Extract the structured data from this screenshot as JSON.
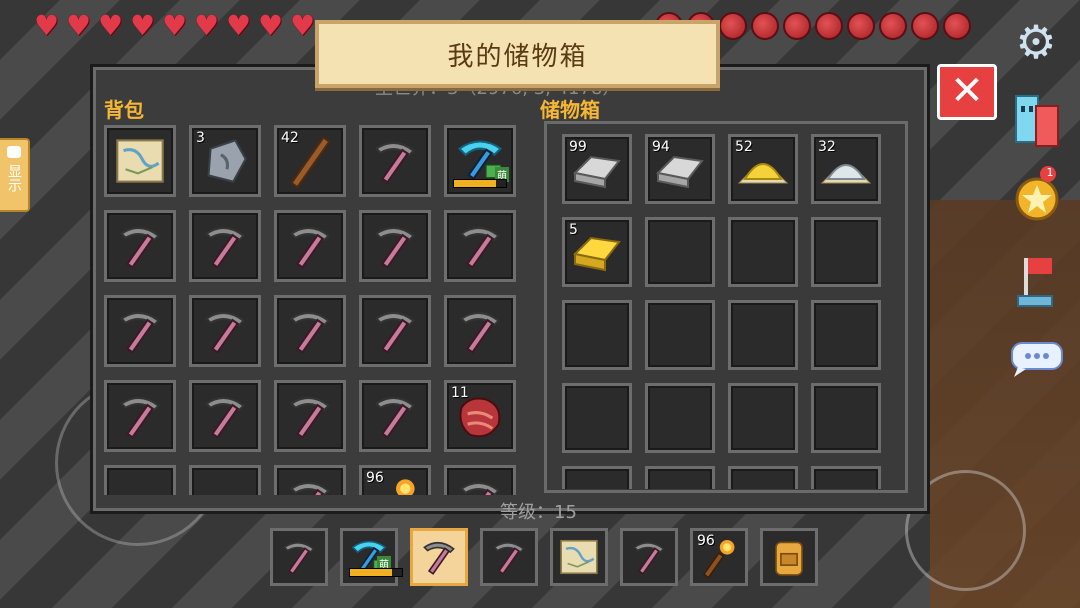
{
  "hud": {
    "hearts": 9,
    "hunger": 10
  },
  "panel": {
    "title": "我的储物箱",
    "coord_text": "主世界：3（2976, 3, 4178）",
    "level_text": "等级：15",
    "bag_label": "背包",
    "chest_label": "储物箱"
  },
  "bag_slots": [
    {
      "item": "map",
      "count": ""
    },
    {
      "item": "stone",
      "count": "3"
    },
    {
      "item": "stick",
      "count": "42"
    },
    {
      "item": "pickaxe",
      "count": ""
    },
    {
      "item": "diamond-pickaxe",
      "count": "",
      "badge": "萌",
      "durability": 0.8
    },
    {
      "item": "pickaxe",
      "count": ""
    },
    {
      "item": "pickaxe",
      "count": ""
    },
    {
      "item": "pickaxe",
      "count": ""
    },
    {
      "item": "pickaxe",
      "count": ""
    },
    {
      "item": "pickaxe",
      "count": ""
    },
    {
      "item": "pickaxe",
      "count": ""
    },
    {
      "item": "pickaxe",
      "count": ""
    },
    {
      "item": "pickaxe",
      "count": ""
    },
    {
      "item": "pickaxe",
      "count": ""
    },
    {
      "item": "pickaxe",
      "count": ""
    },
    {
      "item": "pickaxe",
      "count": ""
    },
    {
      "item": "pickaxe",
      "count": ""
    },
    {
      "item": "pickaxe",
      "count": ""
    },
    {
      "item": "pickaxe",
      "count": ""
    },
    {
      "item": "raw-meat",
      "count": "11"
    },
    {
      "item": "",
      "count": ""
    },
    {
      "item": "shard",
      "count": ""
    },
    {
      "item": "pickaxe",
      "count": ""
    },
    {
      "item": "torch",
      "count": "96"
    },
    {
      "item": "pickaxe",
      "count": ""
    }
  ],
  "chest_slots": [
    {
      "item": "iron-ingot",
      "count": "99"
    },
    {
      "item": "iron-ingot",
      "count": "94"
    },
    {
      "item": "sulfur-pile",
      "count": "52"
    },
    {
      "item": "salt-pile",
      "count": "32"
    },
    {
      "item": "gold-ingot",
      "count": "5"
    },
    {
      "item": "",
      "count": ""
    },
    {
      "item": "",
      "count": ""
    },
    {
      "item": "",
      "count": ""
    },
    {
      "item": "",
      "count": ""
    },
    {
      "item": "",
      "count": ""
    },
    {
      "item": "",
      "count": ""
    },
    {
      "item": "",
      "count": ""
    },
    {
      "item": "",
      "count": ""
    },
    {
      "item": "",
      "count": ""
    },
    {
      "item": "",
      "count": ""
    },
    {
      "item": "",
      "count": ""
    },
    {
      "item": "",
      "count": ""
    },
    {
      "item": "",
      "count": ""
    },
    {
      "item": "",
      "count": ""
    },
    {
      "item": "",
      "count": ""
    }
  ],
  "hotbar": [
    {
      "item": "pickaxe",
      "count": ""
    },
    {
      "item": "diamond-pickaxe",
      "count": "",
      "badge": "萌",
      "durability": 0.8
    },
    {
      "item": "pickaxe",
      "count": "",
      "selected": true
    },
    {
      "item": "pickaxe",
      "count": ""
    },
    {
      "item": "map",
      "count": ""
    },
    {
      "item": "pickaxe",
      "count": ""
    },
    {
      "item": "torch",
      "count": "96"
    },
    {
      "item": "backpack",
      "count": ""
    }
  ],
  "sidebar": {
    "left_tab_label": "显示",
    "achievement_count": "1"
  },
  "colors": {
    "accent": "#f7b733",
    "close": "#e74040",
    "heart": "#e23a4a"
  }
}
